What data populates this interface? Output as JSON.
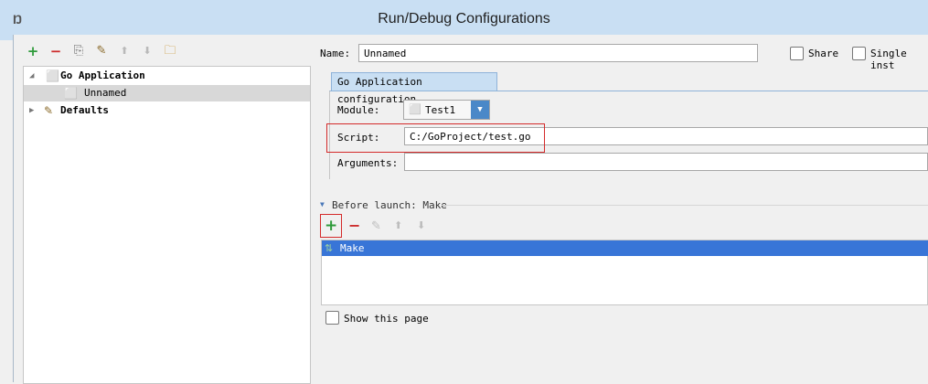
{
  "window": {
    "title": "Run/Debug Configurations",
    "app_icon_glyph": "Ŋ"
  },
  "toolbar": {
    "add": "+",
    "remove": "−",
    "copy": "⎘",
    "edit_defaults": "✎",
    "move_up": "⬆",
    "move_down": "⬇",
    "folder": "🗀"
  },
  "tree": {
    "items": [
      {
        "label": "Go Application",
        "expanded": true,
        "bold": true
      },
      {
        "label": "Unnamed",
        "selected": true
      },
      {
        "label": "Defaults",
        "expanded": false,
        "bold": true
      }
    ]
  },
  "form": {
    "name_label": "Name:",
    "name_value": "Unnamed",
    "share_label": "Share",
    "single_instance_label": "Single inst",
    "tab_label": "Go Application configuration",
    "module_label": "Module:",
    "module_value": "Test1",
    "script_label": "Script:",
    "script_value": "C:/GoProject/test.go",
    "arguments_label": "Arguments:",
    "arguments_value": ""
  },
  "before_launch": {
    "header": "Before launch: Make",
    "toolbar": {
      "add": "+",
      "remove": "−",
      "edit": "✎",
      "up": "⬆",
      "down": "⬇"
    },
    "items": [
      "Make"
    ]
  },
  "show_page_label": "Show this page",
  "colors": {
    "selection": "#3875d7",
    "highlight_box": "#d42a2a",
    "titlebar": "#c9dff3"
  }
}
